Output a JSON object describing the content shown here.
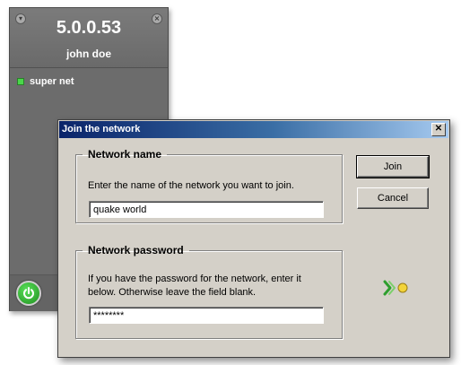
{
  "client": {
    "ip": "5.0.0.53",
    "user": "john doe",
    "network": "super net",
    "menu_glyph": "▾",
    "close_glyph": "×"
  },
  "dialog": {
    "title": "Join the network",
    "close_glyph": "✕",
    "name_group": {
      "legend": "Network name",
      "description": "Enter the name of the network you want to join.",
      "value": "quake world"
    },
    "password_group": {
      "legend": "Network password",
      "description_line1": "If you have the password for the network, enter it",
      "description_line2": "below. Otherwise leave the field blank.",
      "value": "********"
    },
    "join_label": "Join",
    "cancel_label": "Cancel"
  },
  "icons": {
    "power": "power-icon",
    "status": "status-arrow-icon"
  },
  "colors": {
    "title_gradient_start": "#0a246a",
    "title_gradient_end": "#a6caf0",
    "online_green": "#4ad64a",
    "status_yellow": "#f2d33a"
  }
}
